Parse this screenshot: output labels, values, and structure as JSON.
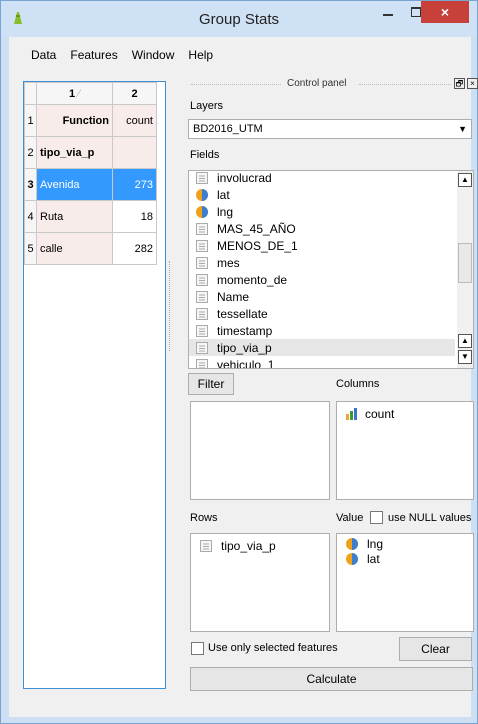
{
  "window": {
    "title": "Group Stats",
    "close": "×"
  },
  "menu": [
    "Data",
    "Features",
    "Window",
    "Help"
  ],
  "table": {
    "col_headers": [
      "1",
      "2"
    ],
    "header_row": {
      "num": "1",
      "c1": "Function",
      "c2": "count"
    },
    "rows": [
      {
        "num": "2",
        "c1": "tipo_via_p",
        "c2": ""
      },
      {
        "num": "3",
        "c1": "Avenida",
        "c2": "273"
      },
      {
        "num": "4",
        "c1": "Ruta",
        "c2": "18"
      },
      {
        "num": "5",
        "c1": "calle",
        "c2": "282"
      }
    ]
  },
  "control_panel": {
    "title": "Control panel",
    "float_glyph": "🗗",
    "close_glyph": "×"
  },
  "layers": {
    "label": "Layers",
    "value": "BD2016_UTM"
  },
  "fields": {
    "label": "Fields",
    "items": [
      {
        "name": "involucrad",
        "type": "text"
      },
      {
        "name": "lat",
        "type": "number"
      },
      {
        "name": "lng",
        "type": "number"
      },
      {
        "name": "MAS_45_AÑO",
        "type": "text"
      },
      {
        "name": "MENOS_DE_1",
        "type": "text"
      },
      {
        "name": "mes",
        "type": "text"
      },
      {
        "name": "momento_de",
        "type": "text"
      },
      {
        "name": "Name",
        "type": "text"
      },
      {
        "name": "tessellate",
        "type": "text"
      },
      {
        "name": "timestamp",
        "type": "text"
      },
      {
        "name": "tipo_via_p",
        "type": "text",
        "highlighted": true
      },
      {
        "name": "vehiculo_1",
        "type": "text"
      }
    ]
  },
  "filter_button": "Filter",
  "columns": {
    "label": "Columns",
    "items": [
      "count"
    ]
  },
  "rows_box": {
    "label": "Rows",
    "items": [
      "tipo_via_p"
    ]
  },
  "value_box": {
    "label": "Value",
    "use_null_label": "use NULL values",
    "items": [
      "lng",
      "lat"
    ]
  },
  "use_selected_label": "Use only selected features",
  "clear_button": "Clear",
  "calculate_button": "Calculate"
}
